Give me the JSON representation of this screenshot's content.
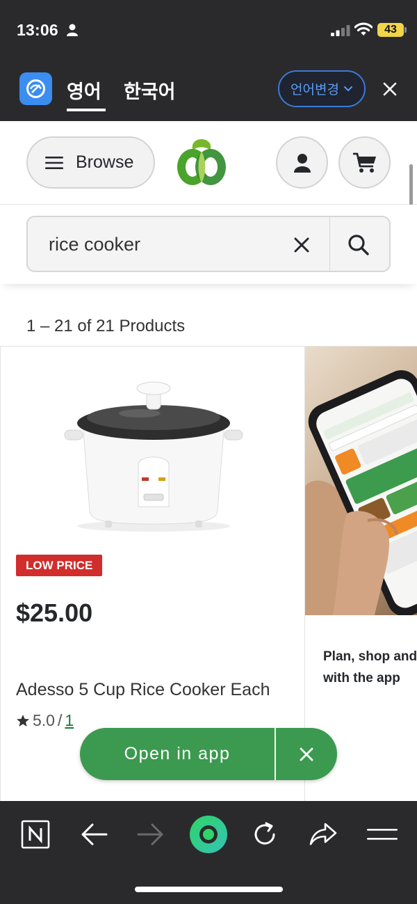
{
  "status_bar": {
    "time": "13:06",
    "battery": "43"
  },
  "translate_bar": {
    "tab_active": "영어",
    "tab_other": "한국어",
    "change_language": "언어변경"
  },
  "header": {
    "browse_label": "Browse"
  },
  "search": {
    "query": "rice cooker"
  },
  "results": {
    "count_text": "1 – 21 of 21 Products"
  },
  "product": {
    "badge": "LOW PRICE",
    "price": "$25.00",
    "name": "Adesso 5 Cup Rice Cooker Each",
    "rating": "5.0",
    "rating_separator": "/",
    "rating_count": "1"
  },
  "promo": {
    "text": "Plan, shop and save with the app"
  },
  "open_app": {
    "label": "Open in app"
  },
  "colors": {
    "brand_green": "#3b9a4f",
    "badge_red": "#d12d2d",
    "dark_chrome": "#2a2a2c",
    "link_blue": "#5b9cf5"
  }
}
